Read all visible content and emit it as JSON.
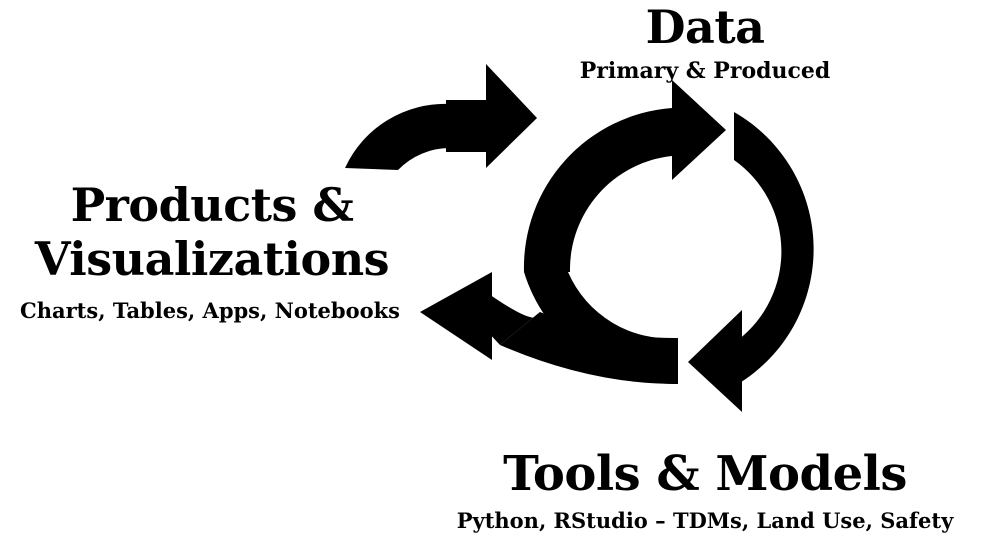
{
  "nodes": {
    "data": {
      "title": "Data",
      "subtitle": "Primary & Produced"
    },
    "products": {
      "title_line1": "Products &",
      "title_line2": "Visualizations",
      "subtitle": "Charts, Tables, Apps, Notebooks"
    },
    "tools": {
      "title": "Tools & Models",
      "subtitle": "Python, RStudio – TDMs, Land Use, Safety"
    }
  },
  "colors": {
    "arrow": "#000000",
    "background": "#ffffff",
    "text": "#000000"
  },
  "icons": {
    "products-to-data": "curved-arrow-icon",
    "cycle-top": "cycle-arrow-icon",
    "cycle-bottom": "cycle-arrow-icon",
    "loop-to-products": "curved-arrow-icon"
  }
}
